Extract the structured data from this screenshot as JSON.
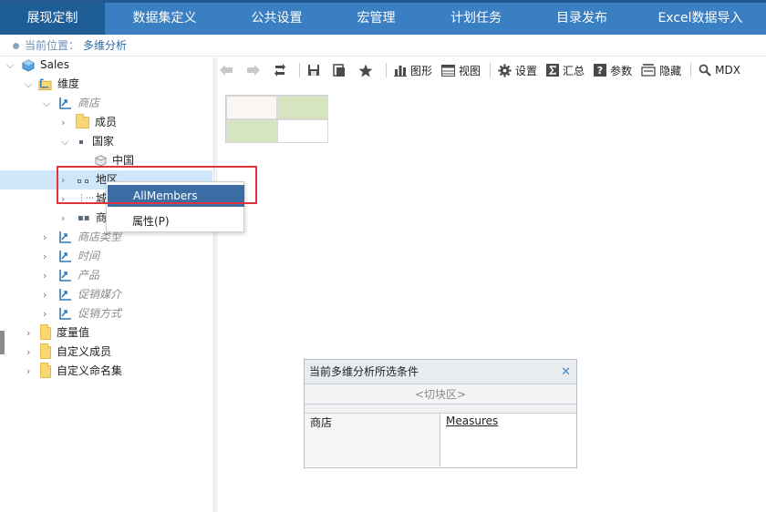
{
  "nav": {
    "tabs": [
      {
        "label": "展现定制"
      },
      {
        "label": "数据集定义"
      },
      {
        "label": "公共设置"
      },
      {
        "label": "宏管理"
      },
      {
        "label": "计划任务"
      },
      {
        "label": "目录发布"
      },
      {
        "label": "Excel数据导入"
      }
    ],
    "active_color": "#1e5d96",
    "bar_color": "#3a7fc1"
  },
  "breadcrumb": {
    "prefix": "当前位置：",
    "current": "多维分析"
  },
  "tree": {
    "root": "Sales",
    "dimensions": "维度",
    "store": "商店",
    "members": "成员",
    "country": "国家",
    "china": "中国",
    "region": "地区",
    "city": "城",
    "shop_short": "商",
    "store_type": "商店类型",
    "time": "时间",
    "product": "产品",
    "promo_media": "促销媒介",
    "promo_method": "促销方式",
    "measures": "度量值",
    "custom_members": "自定义成员",
    "custom_named_sets": "自定义命名集"
  },
  "toolbar": {
    "chart": "图形",
    "view": "视图",
    "settings": "设置",
    "summary": "汇总",
    "params": "参数",
    "hide": "隐藏",
    "mdx": "MDX"
  },
  "context_menu": {
    "all_members": "AllMembers",
    "properties": "属性(P)"
  },
  "filter_panel": {
    "title": "当前多维分析所选条件",
    "slice": "<切块区>",
    "rows": "商店",
    "columns": "Measures"
  }
}
